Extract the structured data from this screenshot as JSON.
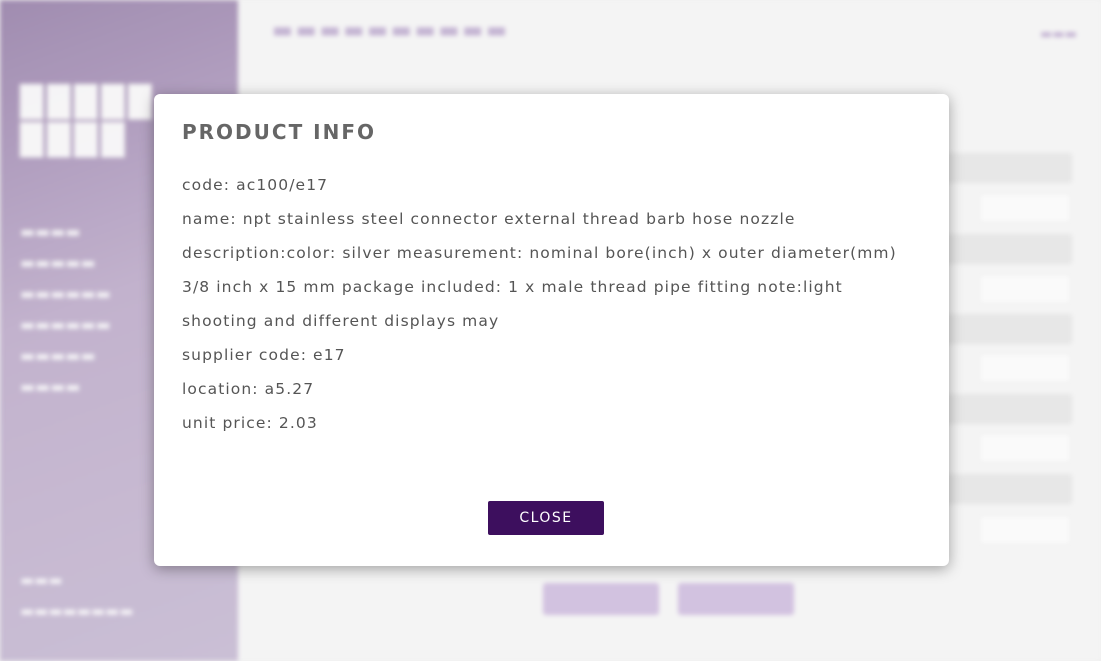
{
  "colors": {
    "accent": "#3d0f5e",
    "sidebar": "#b7a4c6",
    "muted_text": "#c9b8d8"
  },
  "modal": {
    "title": "PRODUCT INFO",
    "fields": [
      "code: ac100/e17",
      "name: npt stainless steel connector external thread barb hose nozzle",
      "description:color: silver measurement: nominal bore(inch) x outer diameter(mm) 3/8 inch x 15 mm package included: 1 x male thread pipe fitting note:light shooting and different displays may",
      "supplier code: e17",
      "location: a5.27",
      "unit price: 2.03"
    ],
    "close_label": "CLOSE"
  }
}
